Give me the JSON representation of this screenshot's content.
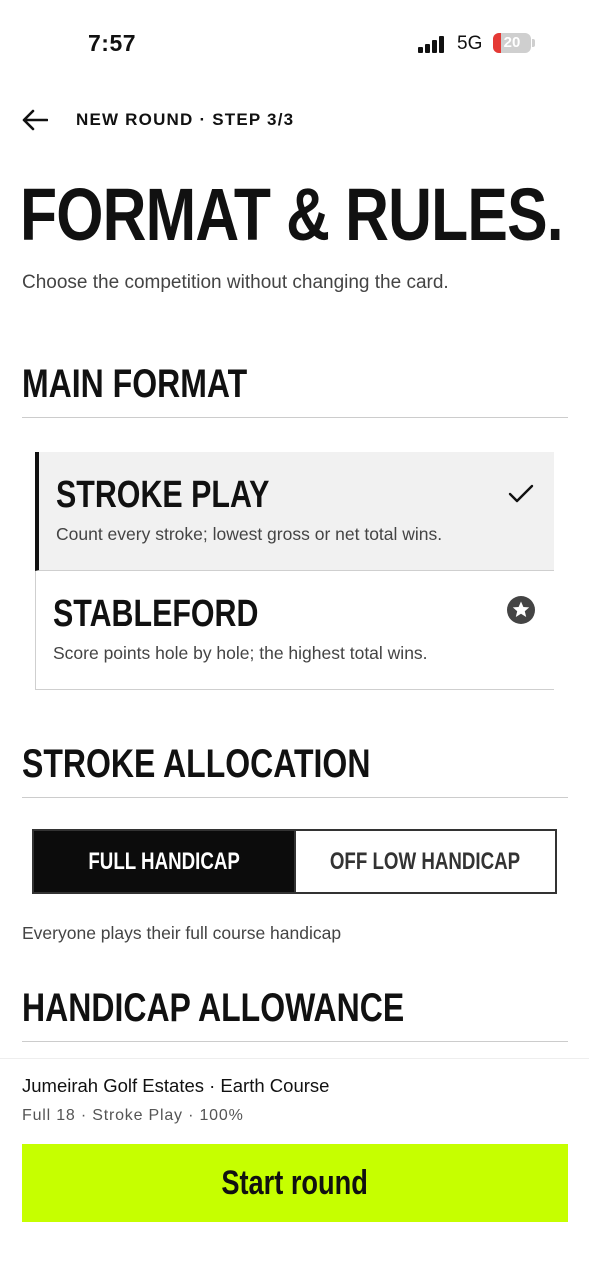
{
  "status_bar": {
    "time": "7:57",
    "network": "5G",
    "battery_level": "20"
  },
  "header": {
    "step_label": "NEW ROUND · STEP 3/3",
    "back_icon": "arrow-left-icon"
  },
  "page": {
    "title": "FORMAT & RULES.",
    "subtitle": "Choose the competition without changing the card."
  },
  "main_format": {
    "section_title": "MAIN FORMAT",
    "options": [
      {
        "name": "STROKE PLAY",
        "description": "Count every stroke; lowest gross or net total wins.",
        "selected": true,
        "icon": "check-icon"
      },
      {
        "name": "STABLEFORD",
        "description": "Score points hole by hole; the highest total wins.",
        "selected": false,
        "icon": "star-circle-icon"
      }
    ]
  },
  "stroke_allocation": {
    "section_title": "STROKE ALLOCATION",
    "segments": [
      {
        "label": "FULL HANDICAP",
        "active": true
      },
      {
        "label": "OFF LOW HANDICAP",
        "active": false
      }
    ],
    "helper_text": "Everyone plays their full course handicap"
  },
  "handicap_allowance": {
    "section_title": "HANDICAP ALLOWANCE"
  },
  "footer": {
    "course_name": "Jumeirah Golf Estates · Earth Course",
    "round_meta": "Full 18 · Stroke Play · 100%",
    "start_label": "Start round"
  },
  "colors": {
    "accent": "#c6ff00",
    "selected_bg": "#f1f1f1",
    "segment_active": "#0c0c0c",
    "battery_low": "#e53935"
  }
}
